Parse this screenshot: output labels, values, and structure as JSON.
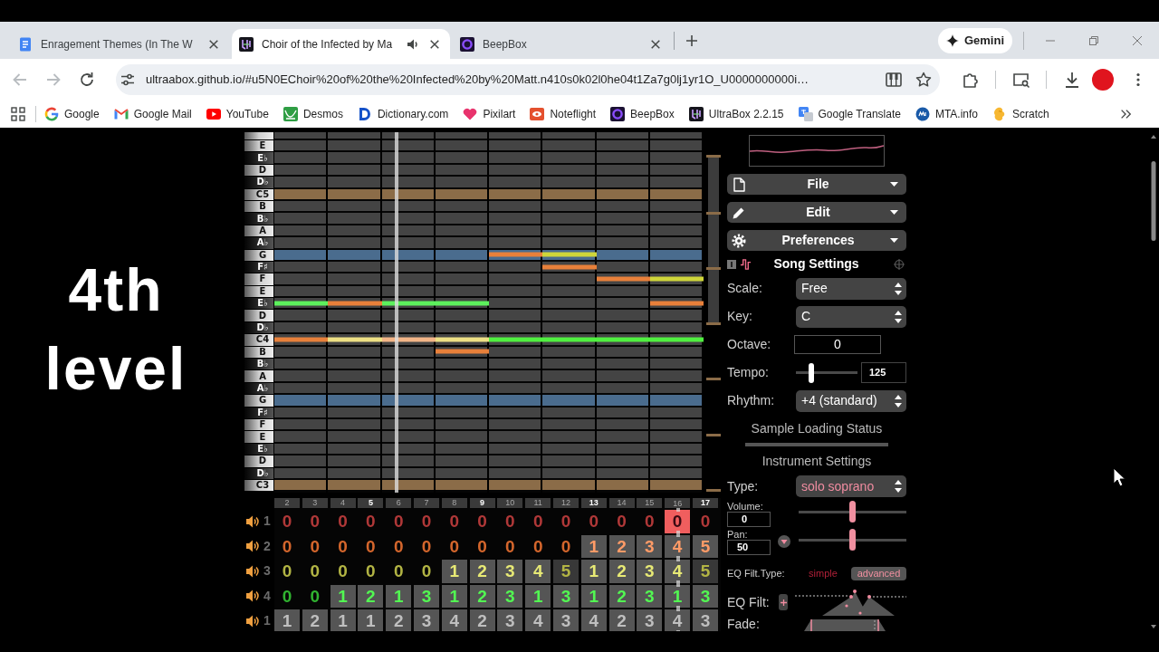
{
  "browser": {
    "tabs": [
      {
        "title": "Enragement Themes (In The W",
        "selected": false,
        "audio": false
      },
      {
        "title": "Choir of the Infected by Ma",
        "selected": true,
        "audio": true
      },
      {
        "title": "BeepBox",
        "selected": false,
        "audio": false
      }
    ],
    "gemini_button": "Gemini",
    "navigation": {
      "back": {
        "disabled": true
      },
      "forward": {
        "disabled": true
      }
    },
    "url": "ultraabox.github.io/#u5N0EChoir%20of%20the%20Infected%20by%20Matt.n410s0k02l0he04t1Za7g0lj1yr1O_U0000000000i…",
    "bookmarks": [
      {
        "label": "Google"
      },
      {
        "label": "Google Mail"
      },
      {
        "label": "YouTube"
      },
      {
        "label": "Desmos"
      },
      {
        "label": "Dictionary.com"
      },
      {
        "label": "Pixilart"
      },
      {
        "label": "Noteflight"
      },
      {
        "label": "BeepBox"
      },
      {
        "label": "UltraBox 2.2.15"
      },
      {
        "label": "Google Translate"
      },
      {
        "label": "MTA.info"
      },
      {
        "label": "Scratch"
      }
    ]
  },
  "caption": "4th level",
  "song_editor": {
    "piano_roll": {
      "keys": [
        {
          "label": "E",
          "kind": "white",
          "color": "#444444"
        },
        {
          "label": "E♭",
          "kind": "black",
          "color": "#444444"
        },
        {
          "label": "D",
          "kind": "white",
          "color": "#444444"
        },
        {
          "label": "D♭",
          "kind": "black",
          "color": "#444444"
        },
        {
          "label": "C5",
          "kind": "white",
          "color": "#8b6c48"
        },
        {
          "label": "B",
          "kind": "white",
          "color": "#444444"
        },
        {
          "label": "B♭",
          "kind": "black",
          "color": "#444444"
        },
        {
          "label": "A",
          "kind": "white",
          "color": "#444444"
        },
        {
          "label": "A♭",
          "kind": "black",
          "color": "#444444"
        },
        {
          "label": "G",
          "kind": "white",
          "color": "#4a6c8e",
          "cells": [
            {
              "note": false
            },
            {
              "note": false
            },
            {
              "note": false
            },
            {
              "note": false
            },
            {
              "note": true,
              "color": "#e8803a"
            },
            {
              "note": true,
              "color": "#cfd63a"
            },
            {
              "note": false
            },
            {
              "note": false
            }
          ]
        },
        {
          "label": "F♯",
          "kind": "black",
          "color": "#444444",
          "cells": [
            {
              "note": false
            },
            {
              "note": false
            },
            {
              "note": false
            },
            {
              "note": false
            },
            {
              "note": false
            },
            {
              "note": true,
              "color": "#e8803a"
            },
            {
              "note": false
            },
            {
              "note": false
            }
          ]
        },
        {
          "label": "F",
          "kind": "white",
          "color": "#444444",
          "cells": [
            {
              "note": false
            },
            {
              "note": false
            },
            {
              "note": false
            },
            {
              "note": false
            },
            {
              "note": false
            },
            {
              "note": false
            },
            {
              "note": true,
              "color": "#e8803a"
            },
            {
              "note": true,
              "color": "#cfd63a"
            }
          ]
        },
        {
          "label": "E",
          "kind": "white",
          "color": "#444444"
        },
        {
          "label": "E♭",
          "kind": "black",
          "color": "#444444",
          "cells": [
            {
              "note": true,
              "color": "#5cf05c"
            },
            {
              "note": true,
              "color": "#e8803a"
            },
            {
              "note": true,
              "color": "#5cf05c"
            },
            {
              "note": true,
              "color": "#5cf05c"
            },
            {
              "note": false
            },
            {
              "note": false
            },
            {
              "note": false
            },
            {
              "note": true,
              "color": "#e8803a"
            }
          ]
        },
        {
          "label": "D",
          "kind": "white",
          "color": "#444444"
        },
        {
          "label": "D♭",
          "kind": "black",
          "color": "#444444"
        },
        {
          "label": "C4",
          "kind": "white",
          "color": "#444444",
          "cells": [
            {
              "note": true,
              "color": "#e8803a"
            },
            {
              "note": true,
              "color": "#ede084"
            },
            {
              "note": true,
              "color": "#f3b587"
            },
            {
              "note": true,
              "color": "#ede084"
            },
            {
              "note": true,
              "color": "#50f040"
            },
            {
              "note": true,
              "color": "#50f040"
            },
            {
              "note": true,
              "color": "#50f040"
            },
            {
              "note": true,
              "color": "#50f040"
            }
          ]
        },
        {
          "label": "B",
          "kind": "white",
          "color": "#444444",
          "cells": [
            {
              "note": false
            },
            {
              "note": false
            },
            {
              "note": false
            },
            {
              "note": true,
              "color": "#e8803a"
            },
            {
              "note": false
            },
            {
              "note": false
            },
            {
              "note": false
            },
            {
              "note": false
            }
          ]
        },
        {
          "label": "B♭",
          "kind": "black",
          "color": "#444444"
        },
        {
          "label": "A",
          "kind": "white",
          "color": "#444444"
        },
        {
          "label": "A♭",
          "kind": "black",
          "color": "#444444"
        },
        {
          "label": "G",
          "kind": "white",
          "color": "#4a6c8e"
        },
        {
          "label": "F♯",
          "kind": "black",
          "color": "#444444"
        },
        {
          "label": "F",
          "kind": "white",
          "color": "#444444"
        },
        {
          "label": "E",
          "kind": "white",
          "color": "#444444"
        },
        {
          "label": "E♭",
          "kind": "black",
          "color": "#444444"
        },
        {
          "label": "D",
          "kind": "white",
          "color": "#444444"
        },
        {
          "label": "D♭",
          "kind": "black",
          "color": "#444444"
        },
        {
          "label": "C3",
          "kind": "white",
          "color": "#8b6c48"
        }
      ],
      "playhead": {
        "level": 0.28
      }
    },
    "bar_numbers": [
      {
        "label": "2",
        "major": false
      },
      {
        "label": "3",
        "major": false
      },
      {
        "label": "4",
        "major": false
      },
      {
        "label": "5",
        "major": true
      },
      {
        "label": "6",
        "major": false
      },
      {
        "label": "7",
        "major": false
      },
      {
        "label": "8",
        "major": false
      },
      {
        "label": "9",
        "major": true
      },
      {
        "label": "10",
        "major": false
      },
      {
        "label": "11",
        "major": false
      },
      {
        "label": "12",
        "major": false
      },
      {
        "label": "13",
        "major": true
      },
      {
        "label": "14",
        "major": false
      },
      {
        "label": "15",
        "major": false
      },
      {
        "label": "16",
        "major": false
      },
      {
        "label": "17",
        "major": true
      }
    ],
    "pattern": {
      "playhead": {
        "level": 0.9
      },
      "channels": [
        {
          "label": "1",
          "color": "#b03838",
          "cells": [
            {
              "text": "0",
              "filled": false,
              "dim": false,
              "selected": false
            },
            {
              "text": "0",
              "filled": false,
              "dim": false,
              "selected": false
            },
            {
              "text": "0",
              "filled": false,
              "dim": false,
              "selected": false
            },
            {
              "text": "0",
              "filled": false,
              "dim": false,
              "selected": false
            },
            {
              "text": "0",
              "filled": false,
              "dim": false,
              "selected": false
            },
            {
              "text": "0",
              "filled": false,
              "dim": false,
              "selected": false
            },
            {
              "text": "0",
              "filled": false,
              "dim": false,
              "selected": false
            },
            {
              "text": "0",
              "filled": false,
              "dim": false,
              "selected": false
            },
            {
              "text": "0",
              "filled": false,
              "dim": false,
              "selected": false
            },
            {
              "text": "0",
              "filled": false,
              "dim": false,
              "selected": false
            },
            {
              "text": "0",
              "filled": false,
              "dim": false,
              "selected": false
            },
            {
              "text": "0",
              "filled": false,
              "dim": false,
              "selected": false
            },
            {
              "text": "0",
              "filled": false,
              "dim": false,
              "selected": false
            },
            {
              "text": "0",
              "filled": false,
              "dim": false,
              "selected": false
            },
            {
              "text": "0",
              "filled": false,
              "dim": false,
              "selected": true
            },
            {
              "text": "0",
              "filled": false,
              "dim": false,
              "selected": false
            }
          ]
        },
        {
          "label": "2",
          "color": "#d4662c",
          "cells": [
            {
              "text": "0",
              "filled": false,
              "dim": false,
              "selected": false
            },
            {
              "text": "0",
              "filled": false,
              "dim": false,
              "selected": false
            },
            {
              "text": "0",
              "filled": false,
              "dim": false,
              "selected": false
            },
            {
              "text": "0",
              "filled": false,
              "dim": false,
              "selected": false
            },
            {
              "text": "0",
              "filled": false,
              "dim": false,
              "selected": false
            },
            {
              "text": "0",
              "filled": false,
              "dim": false,
              "selected": false
            },
            {
              "text": "0",
              "filled": false,
              "dim": false,
              "selected": false
            },
            {
              "text": "0",
              "filled": false,
              "dim": false,
              "selected": false
            },
            {
              "text": "0",
              "filled": false,
              "dim": false,
              "selected": false
            },
            {
              "text": "0",
              "filled": false,
              "dim": false,
              "selected": false
            },
            {
              "text": "0",
              "filled": false,
              "dim": false,
              "selected": false
            },
            {
              "text": "1",
              "filled": true,
              "dim": false,
              "selected": false
            },
            {
              "text": "2",
              "filled": true,
              "dim": false,
              "selected": false
            },
            {
              "text": "3",
              "filled": true,
              "dim": false,
              "selected": false
            },
            {
              "text": "4",
              "filled": true,
              "dim": false,
              "selected": false
            },
            {
              "text": "5",
              "filled": true,
              "dim": false,
              "selected": false
            }
          ]
        },
        {
          "label": "3",
          "color": "#b2b444",
          "cells": [
            {
              "text": "0",
              "filled": false,
              "dim": false,
              "selected": false
            },
            {
              "text": "0",
              "filled": false,
              "dim": false,
              "selected": false
            },
            {
              "text": "0",
              "filled": false,
              "dim": false,
              "selected": false
            },
            {
              "text": "0",
              "filled": false,
              "dim": false,
              "selected": false
            },
            {
              "text": "0",
              "filled": false,
              "dim": false,
              "selected": false
            },
            {
              "text": "0",
              "filled": false,
              "dim": false,
              "selected": false
            },
            {
              "text": "1",
              "filled": true,
              "dim": false,
              "selected": false
            },
            {
              "text": "2",
              "filled": true,
              "dim": false,
              "selected": false
            },
            {
              "text": "3",
              "filled": true,
              "dim": false,
              "selected": false
            },
            {
              "text": "4",
              "filled": true,
              "dim": false,
              "selected": false
            },
            {
              "text": "5",
              "filled": true,
              "dim": true,
              "selected": false
            },
            {
              "text": "1",
              "filled": true,
              "dim": false,
              "selected": false
            },
            {
              "text": "2",
              "filled": true,
              "dim": false,
              "selected": false
            },
            {
              "text": "3",
              "filled": true,
              "dim": false,
              "selected": false
            },
            {
              "text": "4",
              "filled": true,
              "dim": false,
              "selected": false
            },
            {
              "text": "5",
              "filled": true,
              "dim": true,
              "selected": false
            }
          ]
        },
        {
          "label": "4",
          "color": "#30b430",
          "cells": [
            {
              "text": "0",
              "filled": false,
              "dim": false,
              "selected": false
            },
            {
              "text": "0",
              "filled": false,
              "dim": false,
              "selected": false
            },
            {
              "text": "1",
              "filled": true,
              "dim": false,
              "selected": false
            },
            {
              "text": "2",
              "filled": true,
              "dim": false,
              "selected": false
            },
            {
              "text": "1",
              "filled": true,
              "dim": false,
              "selected": false
            },
            {
              "text": "3",
              "filled": true,
              "dim": false,
              "selected": false
            },
            {
              "text": "1",
              "filled": true,
              "dim": false,
              "selected": false
            },
            {
              "text": "2",
              "filled": true,
              "dim": false,
              "selected": false
            },
            {
              "text": "3",
              "filled": true,
              "dim": false,
              "selected": false
            },
            {
              "text": "1",
              "filled": true,
              "dim": false,
              "selected": false
            },
            {
              "text": "3",
              "filled": true,
              "dim": false,
              "selected": false
            },
            {
              "text": "1",
              "filled": true,
              "dim": false,
              "selected": false
            },
            {
              "text": "2",
              "filled": true,
              "dim": false,
              "selected": false
            },
            {
              "text": "3",
              "filled": true,
              "dim": false,
              "selected": false
            },
            {
              "text": "1",
              "filled": true,
              "dim": false,
              "selected": false
            },
            {
              "text": "3",
              "filled": true,
              "dim": false,
              "selected": false
            }
          ]
        },
        {
          "label": "1",
          "cells": [
            {
              "text": "1",
              "filled": true,
              "dim": false,
              "selected": false
            },
            {
              "text": "2",
              "filled": true,
              "dim": false,
              "selected": false
            },
            {
              "text": "1",
              "filled": true,
              "dim": false,
              "selected": false
            },
            {
              "text": "1",
              "filled": true,
              "dim": false,
              "selected": false
            },
            {
              "text": "2",
              "filled": true,
              "dim": false,
              "selected": false
            },
            {
              "text": "3",
              "filled": true,
              "dim": false,
              "selected": false
            },
            {
              "text": "4",
              "filled": true,
              "dim": false,
              "selected": false
            },
            {
              "text": "2",
              "filled": true,
              "dim": false,
              "selected": false
            },
            {
              "text": "3",
              "filled": true,
              "dim": false,
              "selected": false
            },
            {
              "text": "4",
              "filled": true,
              "dim": false,
              "selected": false
            },
            {
              "text": "3",
              "filled": true,
              "dim": false,
              "selected": false
            },
            {
              "text": "4",
              "filled": true,
              "dim": false,
              "selected": false
            },
            {
              "text": "2",
              "filled": true,
              "dim": false,
              "selected": false
            },
            {
              "text": "3",
              "filled": true,
              "dim": false,
              "selected": false
            },
            {
              "text": "4",
              "filled": true,
              "dim": false,
              "selected": false
            },
            {
              "text": "3",
              "filled": true,
              "dim": false,
              "selected": false
            }
          ]
        }
      ]
    },
    "panel": {
      "menus": [
        {
          "label": "File"
        },
        {
          "label": "Edit"
        },
        {
          "label": "Preferences"
        }
      ],
      "song_settings": {
        "title": "Song Settings",
        "rows": [
          {
            "kind": "select",
            "label": "Scale:",
            "value": "Free"
          },
          {
            "kind": "select",
            "label": "Key:",
            "value": "C"
          },
          {
            "kind": "number",
            "label": "Octave:",
            "value": "0"
          },
          {
            "kind": "slider",
            "label": "Tempo:",
            "level": 0.25,
            "value": "125"
          },
          {
            "kind": "select",
            "label": "Rhythm:",
            "value": "+4 (standard)"
          }
        ]
      },
      "sample_loading": {
        "title": "Sample Loading Status"
      },
      "instrument_settings": {
        "title": "Instrument Settings",
        "type": {
          "label": "Type:",
          "value": "solo soprano"
        },
        "volume": {
          "label": "Volume:",
          "value": "0",
          "level": 0.5
        },
        "pan": {
          "label": "Pan:",
          "value": "50",
          "level": 0.5
        },
        "eq_filter_type": {
          "label": "EQ Filt.Type:",
          "options": [
            {
              "label": "simple",
              "selected": false
            },
            {
              "label": "advanced",
              "selected": true
            }
          ]
        },
        "eq_filter": {
          "label": "EQ Filt:"
        },
        "fade": {
          "label": "Fade:"
        }
      }
    }
  }
}
